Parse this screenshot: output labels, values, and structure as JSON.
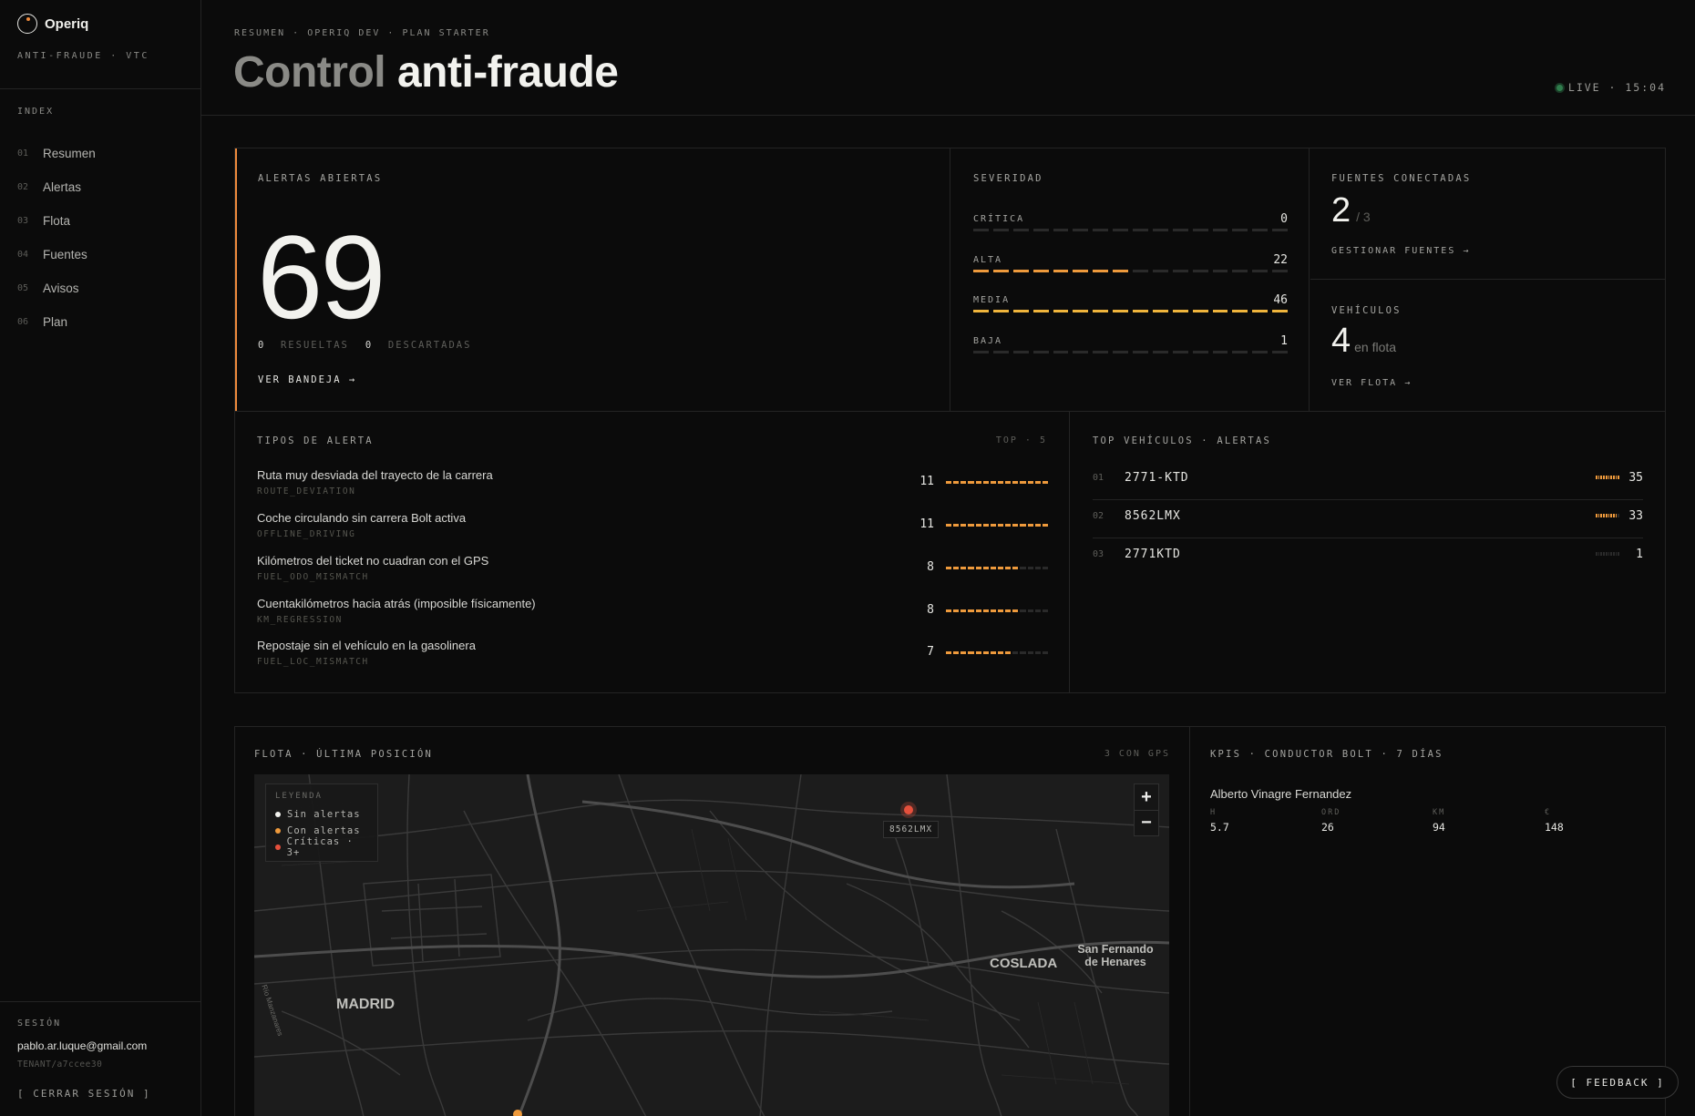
{
  "brand": {
    "name": "Operiq",
    "subtitle": "ANTI-FRAUDE · VTC"
  },
  "sidebar": {
    "index_label": "INDEX",
    "items": [
      {
        "num": "01",
        "label": "Resumen"
      },
      {
        "num": "02",
        "label": "Alertas"
      },
      {
        "num": "03",
        "label": "Flota"
      },
      {
        "num": "04",
        "label": "Fuentes"
      },
      {
        "num": "05",
        "label": "Avisos"
      },
      {
        "num": "06",
        "label": "Plan"
      }
    ],
    "session": {
      "label": "SESIÓN",
      "email": "pablo.ar.luque@gmail.com",
      "tenant": "TENANT/a7ccee30",
      "logout": "[ CERRAR SESIÓN ]"
    }
  },
  "header": {
    "breadcrumb": "RESUMEN · OPERIQ DEV · PLAN STARTER",
    "title_light": "Control",
    "title_strong": "anti-fraude",
    "live": "LIVE · 15:04",
    "live_color": "#2f7d4c"
  },
  "alerts": {
    "caption": "ALERTAS ABIERTAS",
    "count": "69",
    "resolved_count": "0",
    "resolved_label": "RESUELTAS",
    "discarded_count": "0",
    "discarded_label": "DESCARTADAS",
    "link": "VER BANDEJA →",
    "accent": "#ee8a3c"
  },
  "severity": {
    "caption": "SEVERIDAD",
    "rows": [
      {
        "label": "CRÍTICA",
        "value": "0",
        "fraction": 0.0
      },
      {
        "label": "ALTA",
        "value": "22",
        "fraction": 0.48
      },
      {
        "label": "MEDIA",
        "value": "46",
        "fraction": 1.0
      },
      {
        "label": "BAJA",
        "value": "1",
        "fraction": 0.02
      }
    ]
  },
  "sources": {
    "caption": "FUENTES CONECTADAS",
    "count": "2",
    "total": "/ 3",
    "link": "GESTIONAR FUENTES →"
  },
  "vehicles": {
    "caption": "VEHÍCULOS",
    "count": "4",
    "sub": "en flota",
    "link": "VER FLOTA →"
  },
  "alert_types": {
    "caption": "TIPOS DE ALERTA",
    "top_label": "TOP · 5",
    "rows": [
      {
        "name": "Ruta muy desviada del trayecto de la carrera",
        "code": "ROUTE_DEVIATION",
        "count": "11",
        "fraction": 1.0
      },
      {
        "name": "Coche circulando sin carrera Bolt activa",
        "code": "OFFLINE_DRIVING",
        "count": "11",
        "fraction": 1.0
      },
      {
        "name": "Kilómetros del ticket no cuadran con el GPS",
        "code": "FUEL_ODO_MISMATCH",
        "count": "8",
        "fraction": 0.73
      },
      {
        "name": "Cuentakilómetros hacia atrás (imposible físicamente)",
        "code": "KM_REGRESSION",
        "count": "8",
        "fraction": 0.73
      },
      {
        "name": "Repostaje sin el vehículo en la gasolinera",
        "code": "FUEL_LOC_MISMATCH",
        "count": "7",
        "fraction": 0.64
      }
    ]
  },
  "top_vehicles": {
    "caption": "TOP VEHÍCULOS · ALERTAS",
    "rows": [
      {
        "num": "01",
        "plate": "2771-KTD",
        "count": "35",
        "fraction": 1.0
      },
      {
        "num": "02",
        "plate": "8562LMX",
        "count": "33",
        "fraction": 0.94
      },
      {
        "num": "03",
        "plate": "2771KTD",
        "count": "1",
        "fraction": 0.03
      }
    ]
  },
  "fleet_map": {
    "caption": "FLOTA · ÚLTIMA POSICIÓN",
    "gps_label": "3 CON GPS",
    "legend": {
      "title": "LEYENDA",
      "items": [
        {
          "label": "Sin alertas",
          "color": "#f2f2ee"
        },
        {
          "label": "Con alertas",
          "color": "#ee9a3c"
        },
        {
          "label": "Críticas · 3+",
          "color": "#e5503c"
        }
      ]
    },
    "zoom_in": "+",
    "zoom_out": "−",
    "marker_label": "8562LMX",
    "cities": {
      "madrid": "MADRID",
      "coslada": "COSLADA",
      "san_fernando": "San Fernando de Henares",
      "river": "Río Manzanares"
    }
  },
  "kpis": {
    "caption": "KPIS · CONDUCTOR BOLT · 7 DÍAS",
    "driver": "Alberto Vinagre Fernandez",
    "items": [
      {
        "label": "H",
        "value": "5.7"
      },
      {
        "label": "ORD",
        "value": "26"
      },
      {
        "label": "KM",
        "value": "94"
      },
      {
        "label": "€",
        "value": "148"
      }
    ]
  },
  "feedback": "[ FEEDBACK ]"
}
